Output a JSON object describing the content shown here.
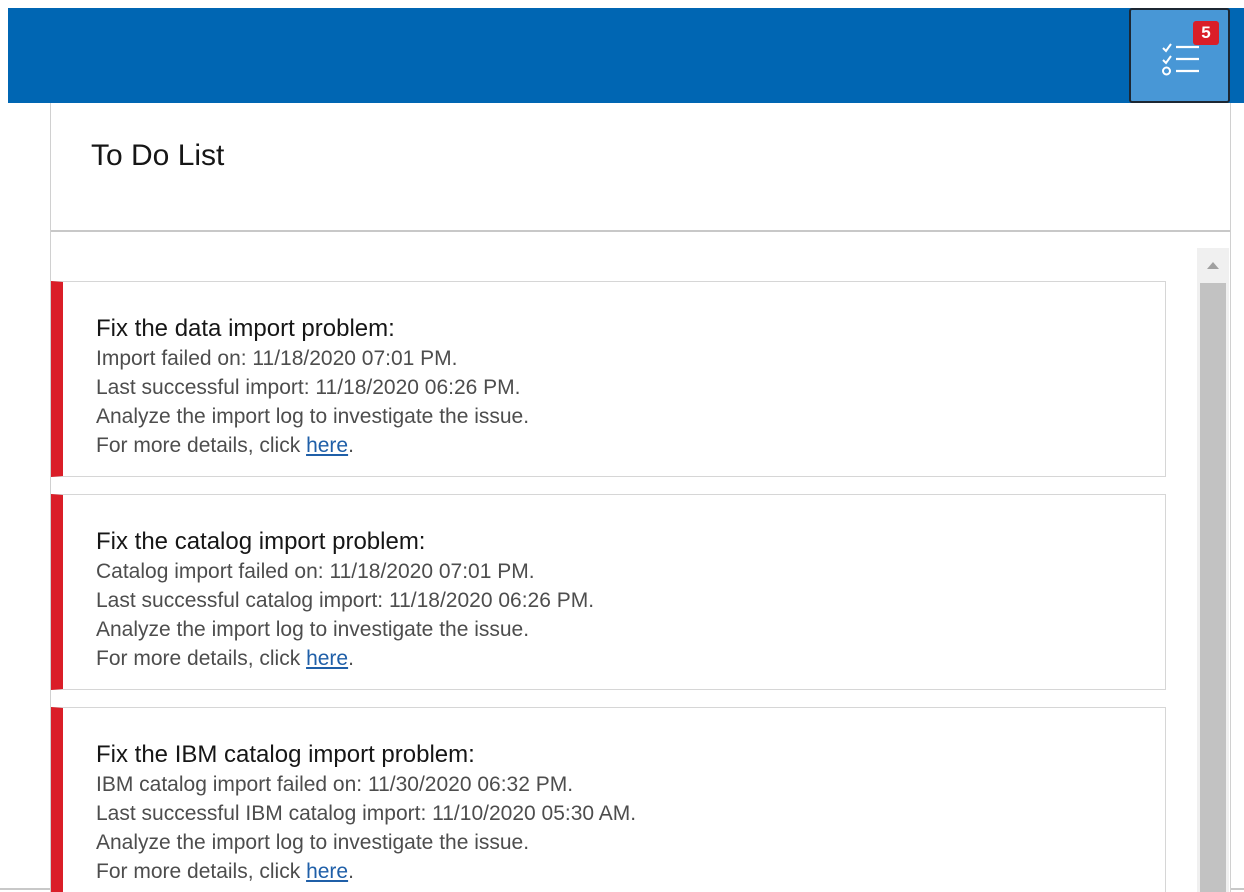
{
  "header": {
    "todo_badge_count": "5",
    "todo_icon": "checklist-icon",
    "colors": {
      "bar": "#0066b3",
      "button": "#4897d6",
      "badge": "#da1e28",
      "card_accent": "#da1e28"
    }
  },
  "panel": {
    "title": "To Do List",
    "items": [
      {
        "title": "Fix the data import problem:",
        "line1": "Import failed on: 11/18/2020 07:01 PM.",
        "line2": "Last successful import: 11/18/2020 06:26 PM.",
        "line3": "Analyze the import log to investigate the issue.",
        "details_prefix": "For more details, click ",
        "details_link": "here",
        "details_suffix": "."
      },
      {
        "title": "Fix the catalog import problem:",
        "line1": "Catalog import failed on: 11/18/2020 07:01 PM.",
        "line2": "Last successful catalog import: 11/18/2020 06:26 PM.",
        "line3": "Analyze the import log to investigate the issue.",
        "details_prefix": "For more details, click ",
        "details_link": "here",
        "details_suffix": "."
      },
      {
        "title": "Fix the IBM catalog import problem:",
        "line1": "IBM catalog import failed on: 11/30/2020 06:32 PM.",
        "line2": "Last successful IBM catalog import: 11/10/2020 05:30 AM.",
        "line3": "Analyze the import log to investigate the issue.",
        "details_prefix": "For more details, click ",
        "details_link": "here",
        "details_suffix": "."
      }
    ]
  }
}
